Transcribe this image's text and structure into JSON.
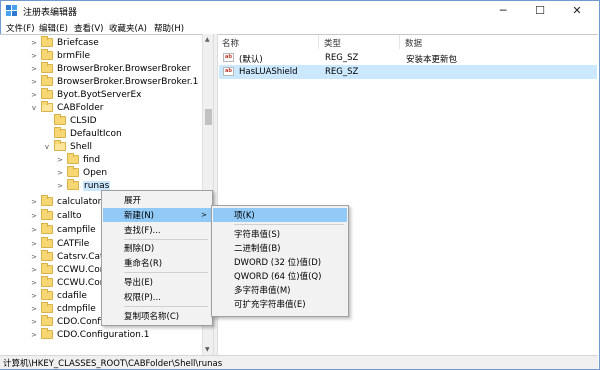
{
  "window": {
    "title": "注册表编辑器",
    "minimize_glyph": "─",
    "maximize_glyph": "☐",
    "close_glyph": "✕"
  },
  "menu": [
    "文件(F)",
    "编辑(E)",
    "查看(V)",
    "收藏夹(A)",
    "帮助(H)"
  ],
  "tree": {
    "items": [
      {
        "label": "Briefcase",
        "twisty": ">"
      },
      {
        "label": "brmFile",
        "twisty": ">"
      },
      {
        "label": "BrowserBroker.BrowserBroker",
        "twisty": ">"
      },
      {
        "label": "BrowserBroker.BrowserBroker.1",
        "twisty": ">"
      },
      {
        "label": "Byot.ByotServerEx",
        "twisty": ">"
      },
      {
        "label": "CABFolder",
        "twisty": "v"
      },
      {
        "label": "CLSID",
        "twisty": ""
      },
      {
        "label": "DefaultIcon",
        "twisty": ""
      },
      {
        "label": "Shell",
        "twisty": "v"
      },
      {
        "label": "find",
        "twisty": ">"
      },
      {
        "label": "Open",
        "twisty": ">"
      },
      {
        "label": "runas",
        "twisty": ">"
      },
      {
        "label": "calculator",
        "twisty": ">"
      },
      {
        "label": "callto",
        "twisty": ">"
      },
      {
        "label": "campfile",
        "twisty": ">"
      },
      {
        "label": "CATFile",
        "twisty": ">"
      },
      {
        "label": "Catsrv.Catalo",
        "twisty": ">"
      },
      {
        "label": "CCWU.ComC",
        "twisty": ">"
      },
      {
        "label": "CCWU.ComC",
        "twisty": ">"
      },
      {
        "label": "cdafile",
        "twisty": ">"
      },
      {
        "label": "cdmpfile",
        "twisty": ">"
      },
      {
        "label": "CDO.Configur",
        "twisty": ">"
      },
      {
        "label": "CDO.Configuration.1",
        "twisty": ">"
      }
    ]
  },
  "list": {
    "columns": [
      "名称",
      "类型",
      "数据"
    ],
    "rows": [
      {
        "icon": "ab",
        "name": "(默认)",
        "type": "REG_SZ",
        "data": "安装本更新包"
      },
      {
        "icon": "ab",
        "name": "HasLUAShield",
        "type": "REG_SZ",
        "data": ""
      }
    ]
  },
  "status": "计算机\\HKEY_CLASSES_ROOT\\CABFolder\\Shell\\runas",
  "context_menu": {
    "items": [
      "展开",
      "新建(N)",
      "查找(F)...",
      "删除(D)",
      "重命名(R)",
      "导出(E)",
      "权限(P)...",
      "复制项名称(C)"
    ],
    "submenu_arrow": ">"
  },
  "submenu": {
    "items": [
      "项(K)",
      "字符串值(S)",
      "二进制值(B)",
      "DWORD (32 位)值(D)",
      "QWORD (64 位)值(Q)",
      "多字符串值(M)",
      "可扩充字符串值(E)"
    ]
  },
  "colors": {
    "selection": "#cce8ff",
    "menu_highlight": "#91c9f7",
    "folder": "#f7d774"
  }
}
